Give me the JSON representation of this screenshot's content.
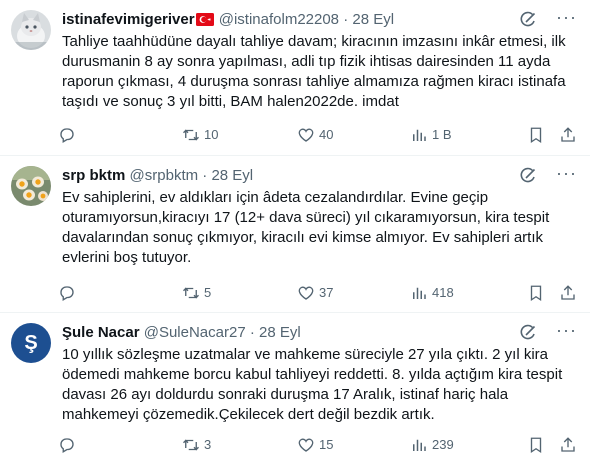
{
  "colors": {
    "text": "#0f1419",
    "secondary": "#536471",
    "divider": "#eff3f4",
    "verified_s_avatar": "#1d4f91"
  },
  "tweets": [
    {
      "display_name": "istinafevimigeriver",
      "flag_icon": "turkey-flag-icon",
      "handle": "@istinafolm22208",
      "separator": "·",
      "date": "28 Eyl",
      "text": "Tahliye taahhüdüne dayalı tahliye davam; kiracının imzasını inkâr etmesi, ilk durusmanin 8 ay sonra yapılması, adli tıp fizik ihtisas dairesinden 11 ayda raporun çıkması, 4 duruşma sonrası tahliye almamıza rağmen kiracı istinafa taşıdı ve sonuç 3 yıl bitti, BAM halen2022de. imdat",
      "replies": "",
      "retweets": "10",
      "likes": "40",
      "views": "1 B"
    },
    {
      "display_name": "srp bktm",
      "handle": "@srpbktm",
      "separator": "·",
      "date": "28 Eyl",
      "text": "Ev sahiplerini, ev aldıkları için âdeta cezalandırdılar. Evine geçip oturamıyorsun,kiracıyı 17 (12+ dava süreci) yıl cıkaramıyorsun, kira tespit davalarından sonuç çıkmıyor, kiracılı evi kimse almıyor. Ev sahipleri artık evlerini boş tutuyor.",
      "replies": "",
      "retweets": "5",
      "likes": "37",
      "views": "418"
    },
    {
      "display_name": "Şule Nacar",
      "avatar_letter": "Ş",
      "handle": "@SuleNacar27",
      "separator": "·",
      "date": "28 Eyl",
      "text": "10 yıllık sözleşme uzatmalar ve mahkeme süreciyle 27 yıla çıktı. 2 yıl kira ödemedi mahkeme borcu kabul tahliyeyi reddetti. 8. yılda açtığım kira tespit davası 26 ayı doldurdu sonraki duruşma 17 Aralık, istinaf hariç hala mahkemeyi çözemedik.Çekilecek dert değil bezdik artık.",
      "replies": "",
      "retweets": "3",
      "likes": "15",
      "views": "239"
    }
  ]
}
